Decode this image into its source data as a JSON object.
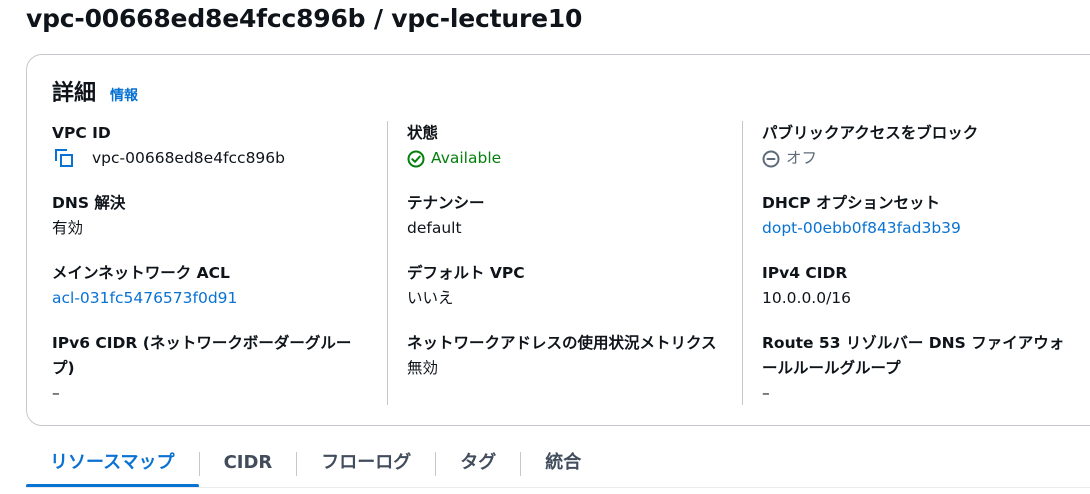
{
  "page": {
    "title": "vpc-00668ed8e4fcc896b / vpc-lecture10"
  },
  "details": {
    "title": "詳細",
    "info_link": "情報",
    "columns": [
      [
        {
          "key": "VPC ID",
          "value": "vpc-00668ed8e4fcc896b",
          "icon": "copy-icon"
        },
        {
          "key": "DNS 解決",
          "value": "有効"
        },
        {
          "key": "メインネットワーク ACL",
          "value": "acl-031fc5476573f0d91",
          "link": true
        },
        {
          "key": "IPv6 CIDR (ネットワークボーダーグループ)",
          "value": "–"
        }
      ],
      [
        {
          "key": "状態",
          "value": "Available",
          "icon": "check-circle-icon",
          "status": "success"
        },
        {
          "key": "テナンシー",
          "value": "default"
        },
        {
          "key": "デフォルト VPC",
          "value": "いいえ"
        },
        {
          "key": "ネットワークアドレスの使用状況メトリクス",
          "value": "無効"
        }
      ],
      [
        {
          "key": "パブリックアクセスをブロック",
          "value": "オフ",
          "icon": "minus-circle-icon",
          "status": "off"
        },
        {
          "key": "DHCP オプションセット",
          "value": "dopt-00ebb0f843fad3b39",
          "link": true
        },
        {
          "key": "IPv4 CIDR",
          "value": "10.0.0.0/16"
        },
        {
          "key": "Route 53 リゾルバー DNS ファイアウォールルールグループ",
          "value": "–"
        }
      ]
    ]
  },
  "tabs": [
    {
      "label": "リソースマップ",
      "active": true
    },
    {
      "label": "CIDR"
    },
    {
      "label": "フローログ"
    },
    {
      "label": "タグ"
    },
    {
      "label": "統合"
    }
  ],
  "colors": {
    "link": "#0972d3",
    "success": "#037f0c",
    "border": "#c6c6cd",
    "muted": "#5f6b7a"
  }
}
